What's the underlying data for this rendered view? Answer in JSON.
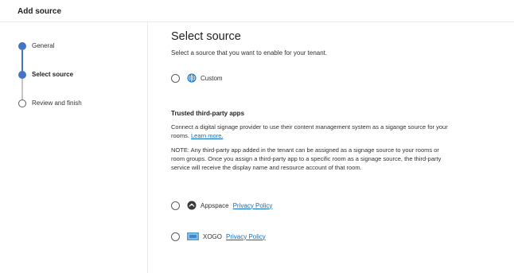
{
  "header": {
    "title": "Add source"
  },
  "steps": [
    {
      "label": "General",
      "state": "completed"
    },
    {
      "label": "Select source",
      "state": "current"
    },
    {
      "label": "Review and finish",
      "state": "pending"
    }
  ],
  "main": {
    "title": "Select source",
    "subtitle": "Select a source that you want to enable for your tenant.",
    "custom_option": {
      "label": "Custom",
      "icon": "globe-icon",
      "selected": false
    },
    "trusted": {
      "title": "Trusted third-party apps",
      "description": "Connect a digital signage provider to use their content management system as a sigange source for your rooms.",
      "learn_more": "Learn more.",
      "note": "NOTE: Any third-party app added in the tenant can be assigned as a signage source to your rooms or room groups. Once you assign a third-party app to a specific room as a signage source, the third-party service will receive the display name and resource account of that room."
    },
    "apps": [
      {
        "name": "Appspace",
        "link": "Privacy Policy",
        "icon": "appspace-logo-icon",
        "selected": false
      },
      {
        "name": "XOGO",
        "link": "Privacy Policy",
        "icon": "xogo-logo-icon",
        "selected": false
      }
    ]
  },
  "colors": {
    "accent": "#4472c4",
    "link": "#0f6cbd",
    "text": "#323130",
    "divider": "#edebe9"
  }
}
